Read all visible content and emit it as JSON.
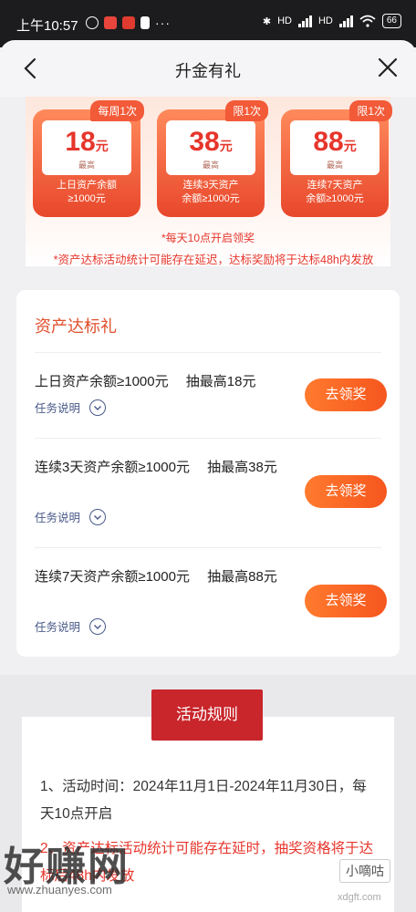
{
  "status_bar": {
    "time": "上午10:57",
    "dots": "···",
    "hd1": "HD",
    "hd2": "HD",
    "battery": "66"
  },
  "header": {
    "title": "升金有礼"
  },
  "banner": {
    "prizes": [
      {
        "tag": "每周1次",
        "amount": "18",
        "unit": "元",
        "max_label": "最高",
        "desc_line1": "上日资产余额",
        "desc_line2": "≥1000元"
      },
      {
        "tag": "限1次",
        "amount": "38",
        "unit": "元",
        "max_label": "最高",
        "desc_line1": "连续3天资产",
        "desc_line2": "余额≥1000元"
      },
      {
        "tag": "限1次",
        "amount": "88",
        "unit": "元",
        "max_label": "最高",
        "desc_line1": "连续7天资产",
        "desc_line2": "余额≥1000元"
      }
    ],
    "note1": "*每天10点开启领奖",
    "note2": "*资产达标活动统计可能存在延迟，达标奖励将于达标48h内发放"
  },
  "task_card": {
    "title": "资产达标礼",
    "tasks": [
      {
        "text": "上日资产余额≥1000元　 抽最高18元",
        "help": "任务说明",
        "button": "去领奖"
      },
      {
        "text": "连续3天资产余额≥1000元　 抽最高38元",
        "help": "任务说明",
        "button": "去领奖"
      },
      {
        "text": "连续7天资产余额≥1000元　 抽最高88元",
        "help": "任务说明",
        "button": "去领奖"
      }
    ]
  },
  "rules": {
    "button": "活动规则",
    "rule1": "1、活动时间：2024年11月1日-2024年11月30日，每天10点开启",
    "rule2": "2、资产达标活动统计可能存在延时，抽奖资格将于达标后48h内发放"
  },
  "watermarks": {
    "big": "好赚网",
    "url": "www.zhuanyes.com",
    "badge": "小嘀咕",
    "site": "xdgft.com"
  },
  "colors": {
    "accent_red": "#e6352b",
    "button_orange": "#f6561e",
    "rules_red": "#c8262b",
    "link_blue": "#4a5a8a"
  }
}
